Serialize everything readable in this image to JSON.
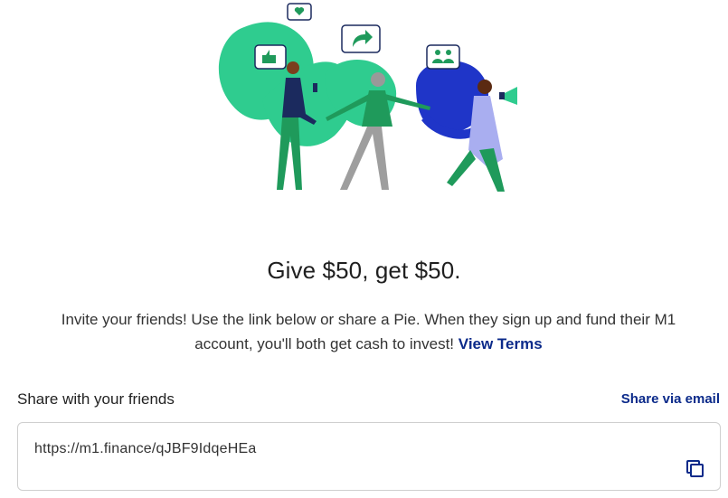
{
  "headline": "Give $50, get $50.",
  "body": {
    "text": "Invite your friends! Use the link below or share a Pie. When they sign up and fund their M1 account, you'll both get cash to invest!",
    "link_label": "View Terms"
  },
  "share": {
    "label": "Share with your friends",
    "email_label": "Share via email",
    "link_value": "https://m1.finance/qJBF9IdqeHEa"
  },
  "icons": {
    "copy": "copy-icon",
    "heart": "heart-icon",
    "thumbs_up": "thumbs-up-icon",
    "share_arrow": "share-arrow-icon",
    "people": "people-icon",
    "megaphone": "megaphone-icon"
  },
  "colors": {
    "brand_link": "#0b2a8a",
    "green_light": "#2fcc8f",
    "green_dark": "#1f9a5b",
    "navy": "#1b2a5e",
    "blue": "#1f35c8"
  }
}
